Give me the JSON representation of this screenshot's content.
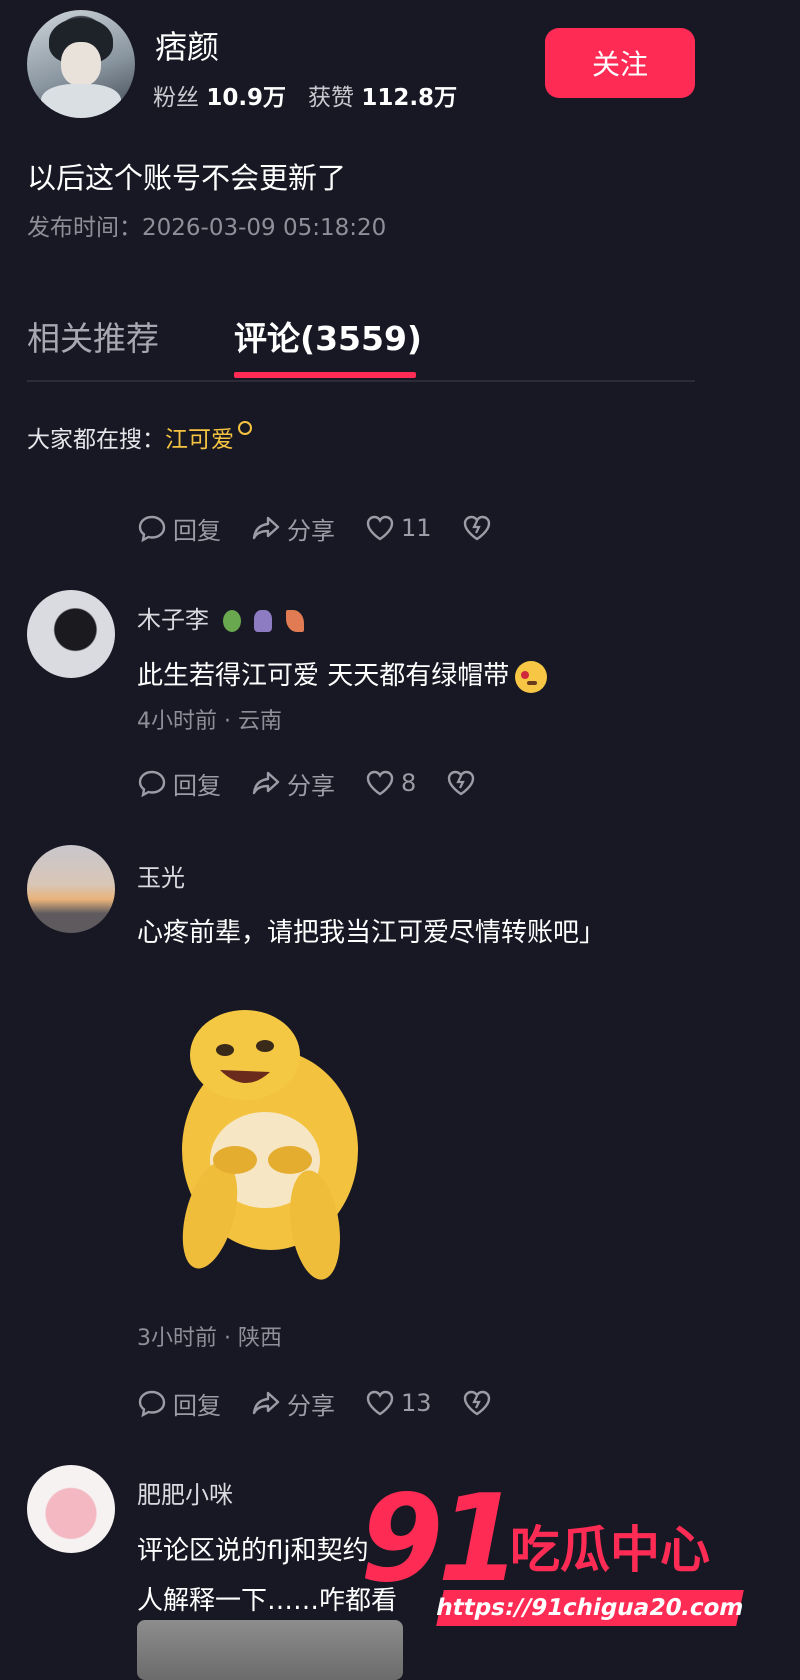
{
  "profile": {
    "name": "痞颜",
    "fans_label": "粉丝",
    "fans": "10.9万",
    "likes_label": "获赞",
    "likes": "112.8万",
    "follow_label": "关注"
  },
  "post": {
    "text": "以后这个账号不会更新了",
    "time_label": "发布时间：",
    "time": "2026-03-09 05:18:20"
  },
  "tabs": [
    {
      "label": "相关推荐"
    },
    {
      "label": "评论(3559)"
    }
  ],
  "search": {
    "label": "大家都在搜：",
    "term": "江可爱"
  },
  "actions": {
    "reply": "回复",
    "share": "分享"
  },
  "top_actions": {
    "likes": "11"
  },
  "comments": [
    {
      "name": "木子李",
      "text": "此生若得江可爱 天天都有绿帽带",
      "meta": "4小时前 · 云南",
      "likes": "8"
    },
    {
      "name": "玉光",
      "text": "心疼前辈，请把我当江可爱尽情转账吧」",
      "meta": "3小时前 · 陕西",
      "likes": "13"
    },
    {
      "name": "肥肥小咪",
      "text_line1": "评论区说的flj和契约",
      "text_line2": "人解释一下……咋都看"
    }
  ],
  "watermark": {
    "number": "91",
    "brand": "吃瓜中心",
    "url": "https://91chigua20.com"
  },
  "colors": {
    "background": "#171823",
    "accent": "#fe2c55",
    "search_term": "#f5c242",
    "muted_text": "#8e8f98"
  }
}
